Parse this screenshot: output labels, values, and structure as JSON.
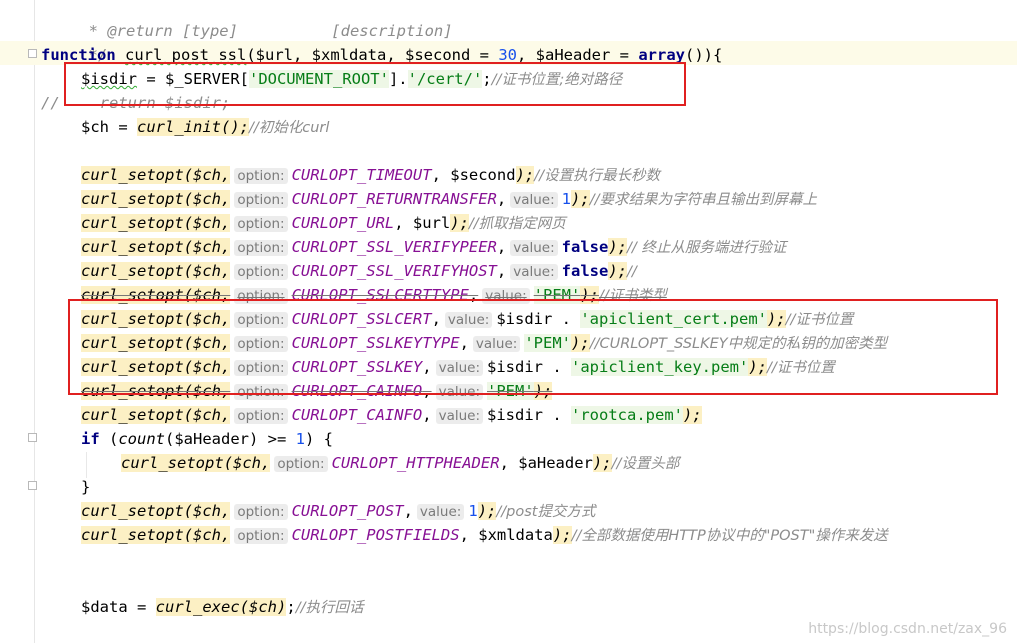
{
  "lines": {
    "doc_return": " * @return [type]          [description]",
    "doc_end": " */",
    "fn_kw": "function",
    "fn_name": "curl_post_ssl",
    "fn_params_1": "(",
    "p_url": "$url",
    "comma": ", ",
    "p_xml": "$xmldata",
    "p_second": "$second",
    "eq": " = ",
    "p_second_default": "30",
    "p_header": "$aHeader",
    "arr": "array",
    "fn_end": "()){",
    "isdir_var": "$isdir",
    "isdir_assign": " = $_SERVER[",
    "isdir_key": "'DOCUMENT_ROOT'",
    "isdir_mid": "].",
    "isdir_path": "'/cert/'",
    "isdir_semi": ";",
    "isdir_cmt": "//证书位置;绝对路径",
    "commented_slashes": "//",
    "commented_return": "return $isdir;",
    "ch_var": "$ch",
    "ch_init": "curl_init",
    "ch_init_cmt": "//初始化curl",
    "setopt": "curl_setopt",
    "opt_hint": "option:",
    "val_hint": "value:",
    "ch_arg": "($ch,",
    "o1": "CURLOPT_TIMEOUT",
    "o1_v": "$second",
    "o1_c": "//设置执行最长秒数",
    "o2": "CURLOPT_RETURNTRANSFER",
    "o2_v": "1",
    "o2_c": "//要求结果为字符串且输出到屏幕上",
    "o3": "CURLOPT_URL",
    "o3_v": "$url",
    "o3_c": "//抓取指定网页",
    "o4": "CURLOPT_SSL_VERIFYPEER",
    "o4_v": "false",
    "o4_c": "// 终止从服务端进行验证",
    "o5": "CURLOPT_SSL_VERIFYHOST",
    "o5_v": "false",
    "o5_c": "//",
    "o6": "CURLOPT_SSLCERTTYPE",
    "o6_v": "'PEM'",
    "o6_c": "//证书类型",
    "o7": "CURLOPT_SSLCERT",
    "o7_v1": "$isdir",
    "o7_dot": " . ",
    "o7_v2": "'apiclient_cert.pem'",
    "o7_c": "//证书位置",
    "o8": "CURLOPT_SSLKEYTYPE",
    "o8_v": "'PEM'",
    "o8_c": "//CURLOPT_SSLKEY中规定的私钥的加密类型",
    "o9": "CURLOPT_SSLKEY",
    "o9_v1": "$isdir",
    "o9_v2": "'apiclient_key.pem'",
    "o9_c": "//证书位置",
    "o10": "CURLOPT_CAINFO",
    "o10_v": "'PEM'",
    "o11": "CURLOPT_CAINFO",
    "o11_v1": "$isdir",
    "o11_v2": "'rootca.pem'",
    "if_kw": "if",
    "if_open": " (",
    "count_fn": "count",
    "if_var": "($aHeader)",
    "if_cmp": " >= ",
    "if_num": "1",
    "if_close": ") {",
    "o12": "CURLOPT_HTTPHEADER",
    "o12_v": "$aHeader",
    "o12_c": "//设置头部",
    "close_brace": "}",
    "o13": "CURLOPT_POST",
    "o13_v": "1",
    "o13_c": "//post提交方式",
    "o14": "CURLOPT_POSTFIELDS",
    "o14_v": "$xmldata",
    "o14_c": "//全部数据使用HTTP协议中的\"POST\"操作来发送",
    "data_var": "$data",
    "exec_fn": "curl_exec",
    "exec_arg": "($ch)",
    "exec_c": "//执行回话",
    "paren_close": ");",
    "semi_close": "();"
  },
  "watermark": "https://blog.csdn.net/zax_96",
  "colors": {
    "highlight_box": "#e02020",
    "keyword": "#000080",
    "constant": "#871094",
    "string": "#067d17",
    "number": "#1750eb",
    "comment": "#8c8c8c"
  }
}
